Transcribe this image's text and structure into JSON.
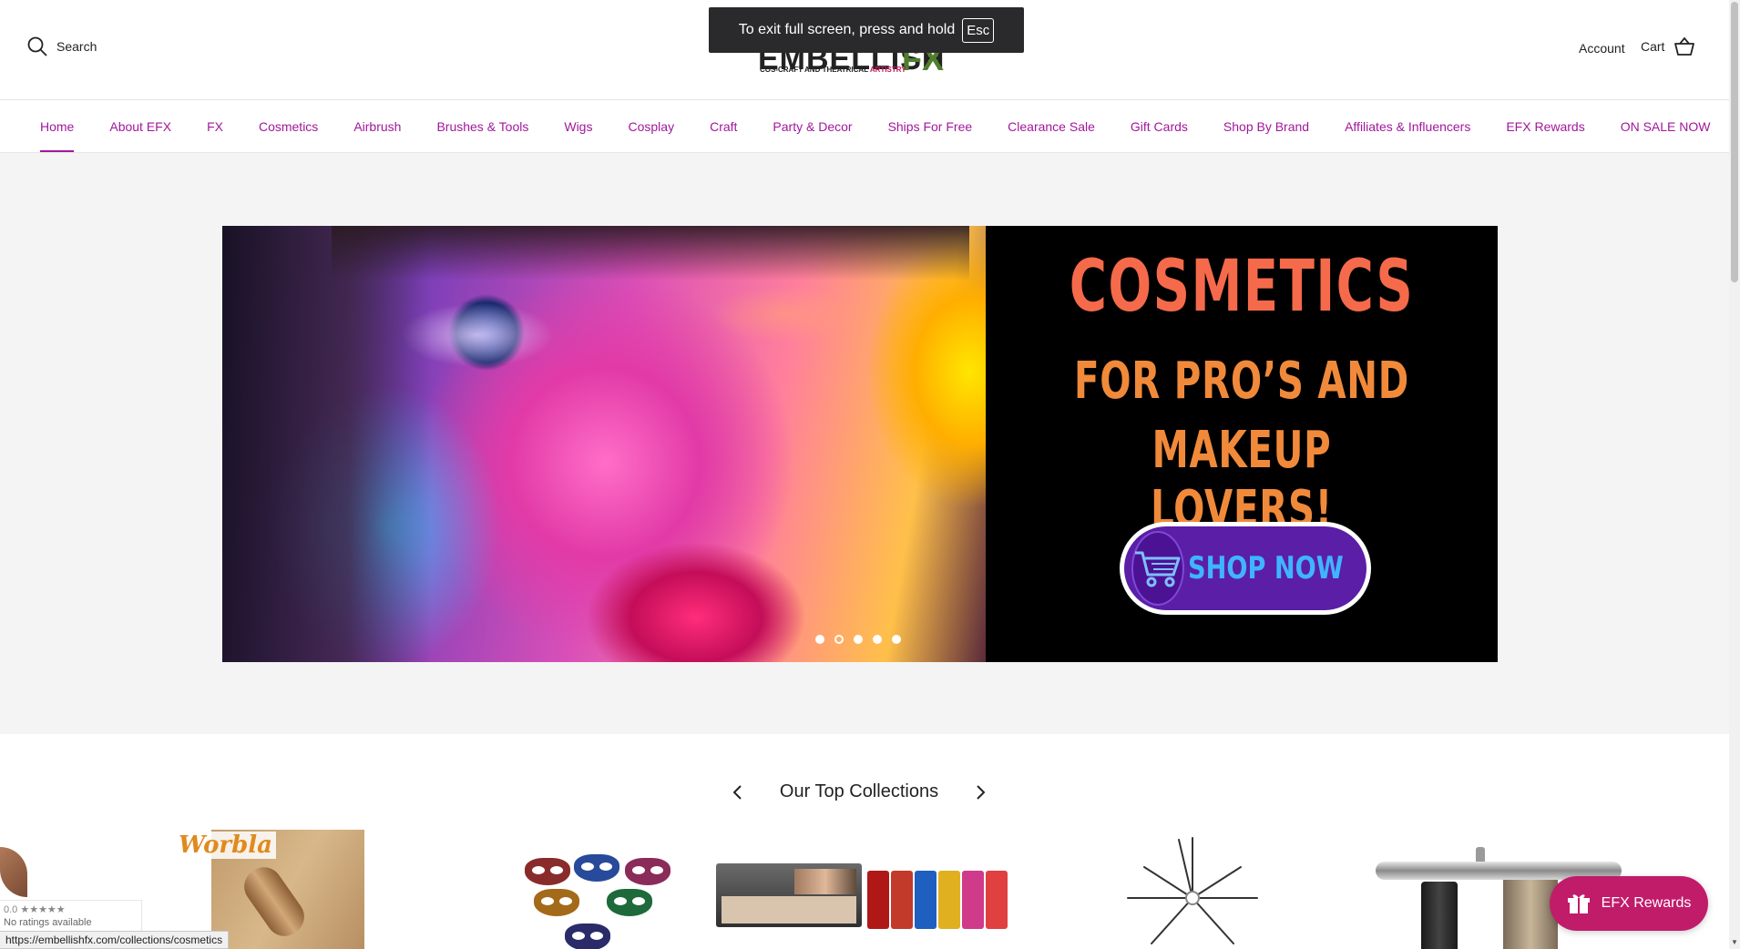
{
  "header": {
    "search_label": "Search",
    "logo_text": "EMBELLISH",
    "logo_fx": "FX",
    "logo_tagline": "COS-CRAFT AND THEATRICAL",
    "logo_tagline_accent": "ARTISTRY",
    "account_label": "Account",
    "cart_label": "Cart"
  },
  "fullscreen_toast": {
    "message": "To exit full screen, press and hold",
    "key": "Esc"
  },
  "nav": {
    "items": [
      {
        "label": "Home",
        "active": true
      },
      {
        "label": "About EFX"
      },
      {
        "label": "FX"
      },
      {
        "label": "Cosmetics"
      },
      {
        "label": "Airbrush"
      },
      {
        "label": "Brushes & Tools"
      },
      {
        "label": "Wigs"
      },
      {
        "label": "Cosplay"
      },
      {
        "label": "Craft"
      },
      {
        "label": "Party & Decor"
      },
      {
        "label": "Ships For Free"
      },
      {
        "label": "Clearance Sale"
      },
      {
        "label": "Gift Cards"
      },
      {
        "label": "Shop By Brand"
      },
      {
        "label": "Affiliates & Influencers"
      },
      {
        "label": "EFX Rewards"
      },
      {
        "label": "ON SALE NOW"
      }
    ]
  },
  "hero": {
    "title": "COSMETICS",
    "line2": "FOR PRO’S AND",
    "line3": "MAKEUP LOVERS!",
    "button_label": "SHOP NOW",
    "slide_count": 5,
    "active_slide": 2
  },
  "collections": {
    "title": "Our Top Collections",
    "worbla_brand": "Worbla"
  },
  "rewards": {
    "label": "EFX Rewards"
  },
  "review_badge": {
    "rating": "0.0 ★★★★★",
    "subtext": "No ratings available"
  },
  "status_url": "https://embellishfx.com/collections/cosmetics",
  "colors": {
    "nav_accent": "#a2179b",
    "rewards_bg": "#c01c6a",
    "hero_title": "#f56a4a",
    "hero_subtitle": "#f08a3a",
    "shop_button": "#5b1ea6"
  },
  "icons": {
    "search": "search-icon",
    "cart": "cart-icon",
    "prev": "chevron-left-icon",
    "next": "chevron-right-icon",
    "gift": "gift-icon"
  }
}
